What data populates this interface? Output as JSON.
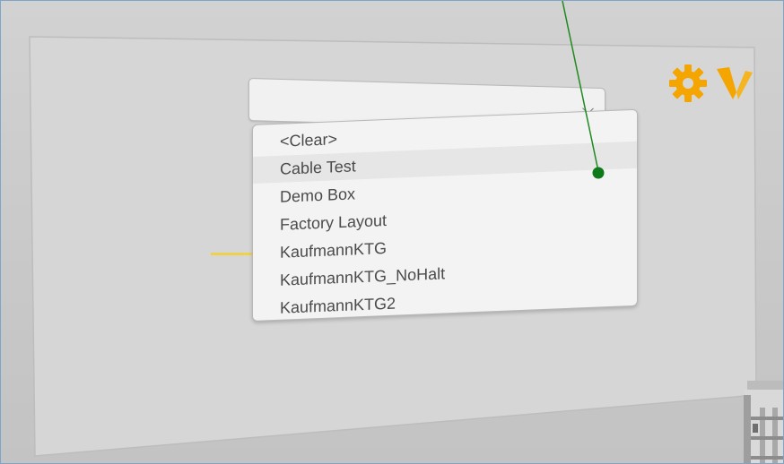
{
  "dropdown": {
    "selected_value": "",
    "options": [
      "<Clear>",
      "Cable Test",
      "Demo Box",
      "Factory Layout",
      "KaufmannKTG",
      "KaufmannKTG_NoHalt",
      "KaufmannKTG2"
    ],
    "highlighted_index": 1
  },
  "icons": {
    "settings": "gear-icon",
    "logo": "v-logo-icon",
    "chevron": "chevron-down-icon",
    "pointer": "laser-pointer-dot"
  },
  "colors": {
    "accent": "#f5a500",
    "laser": "#1e8a1e",
    "pointer_dot": "#0f7a1a",
    "panel": "#d6d6d6",
    "highlight_row": "#e6e6e6"
  }
}
